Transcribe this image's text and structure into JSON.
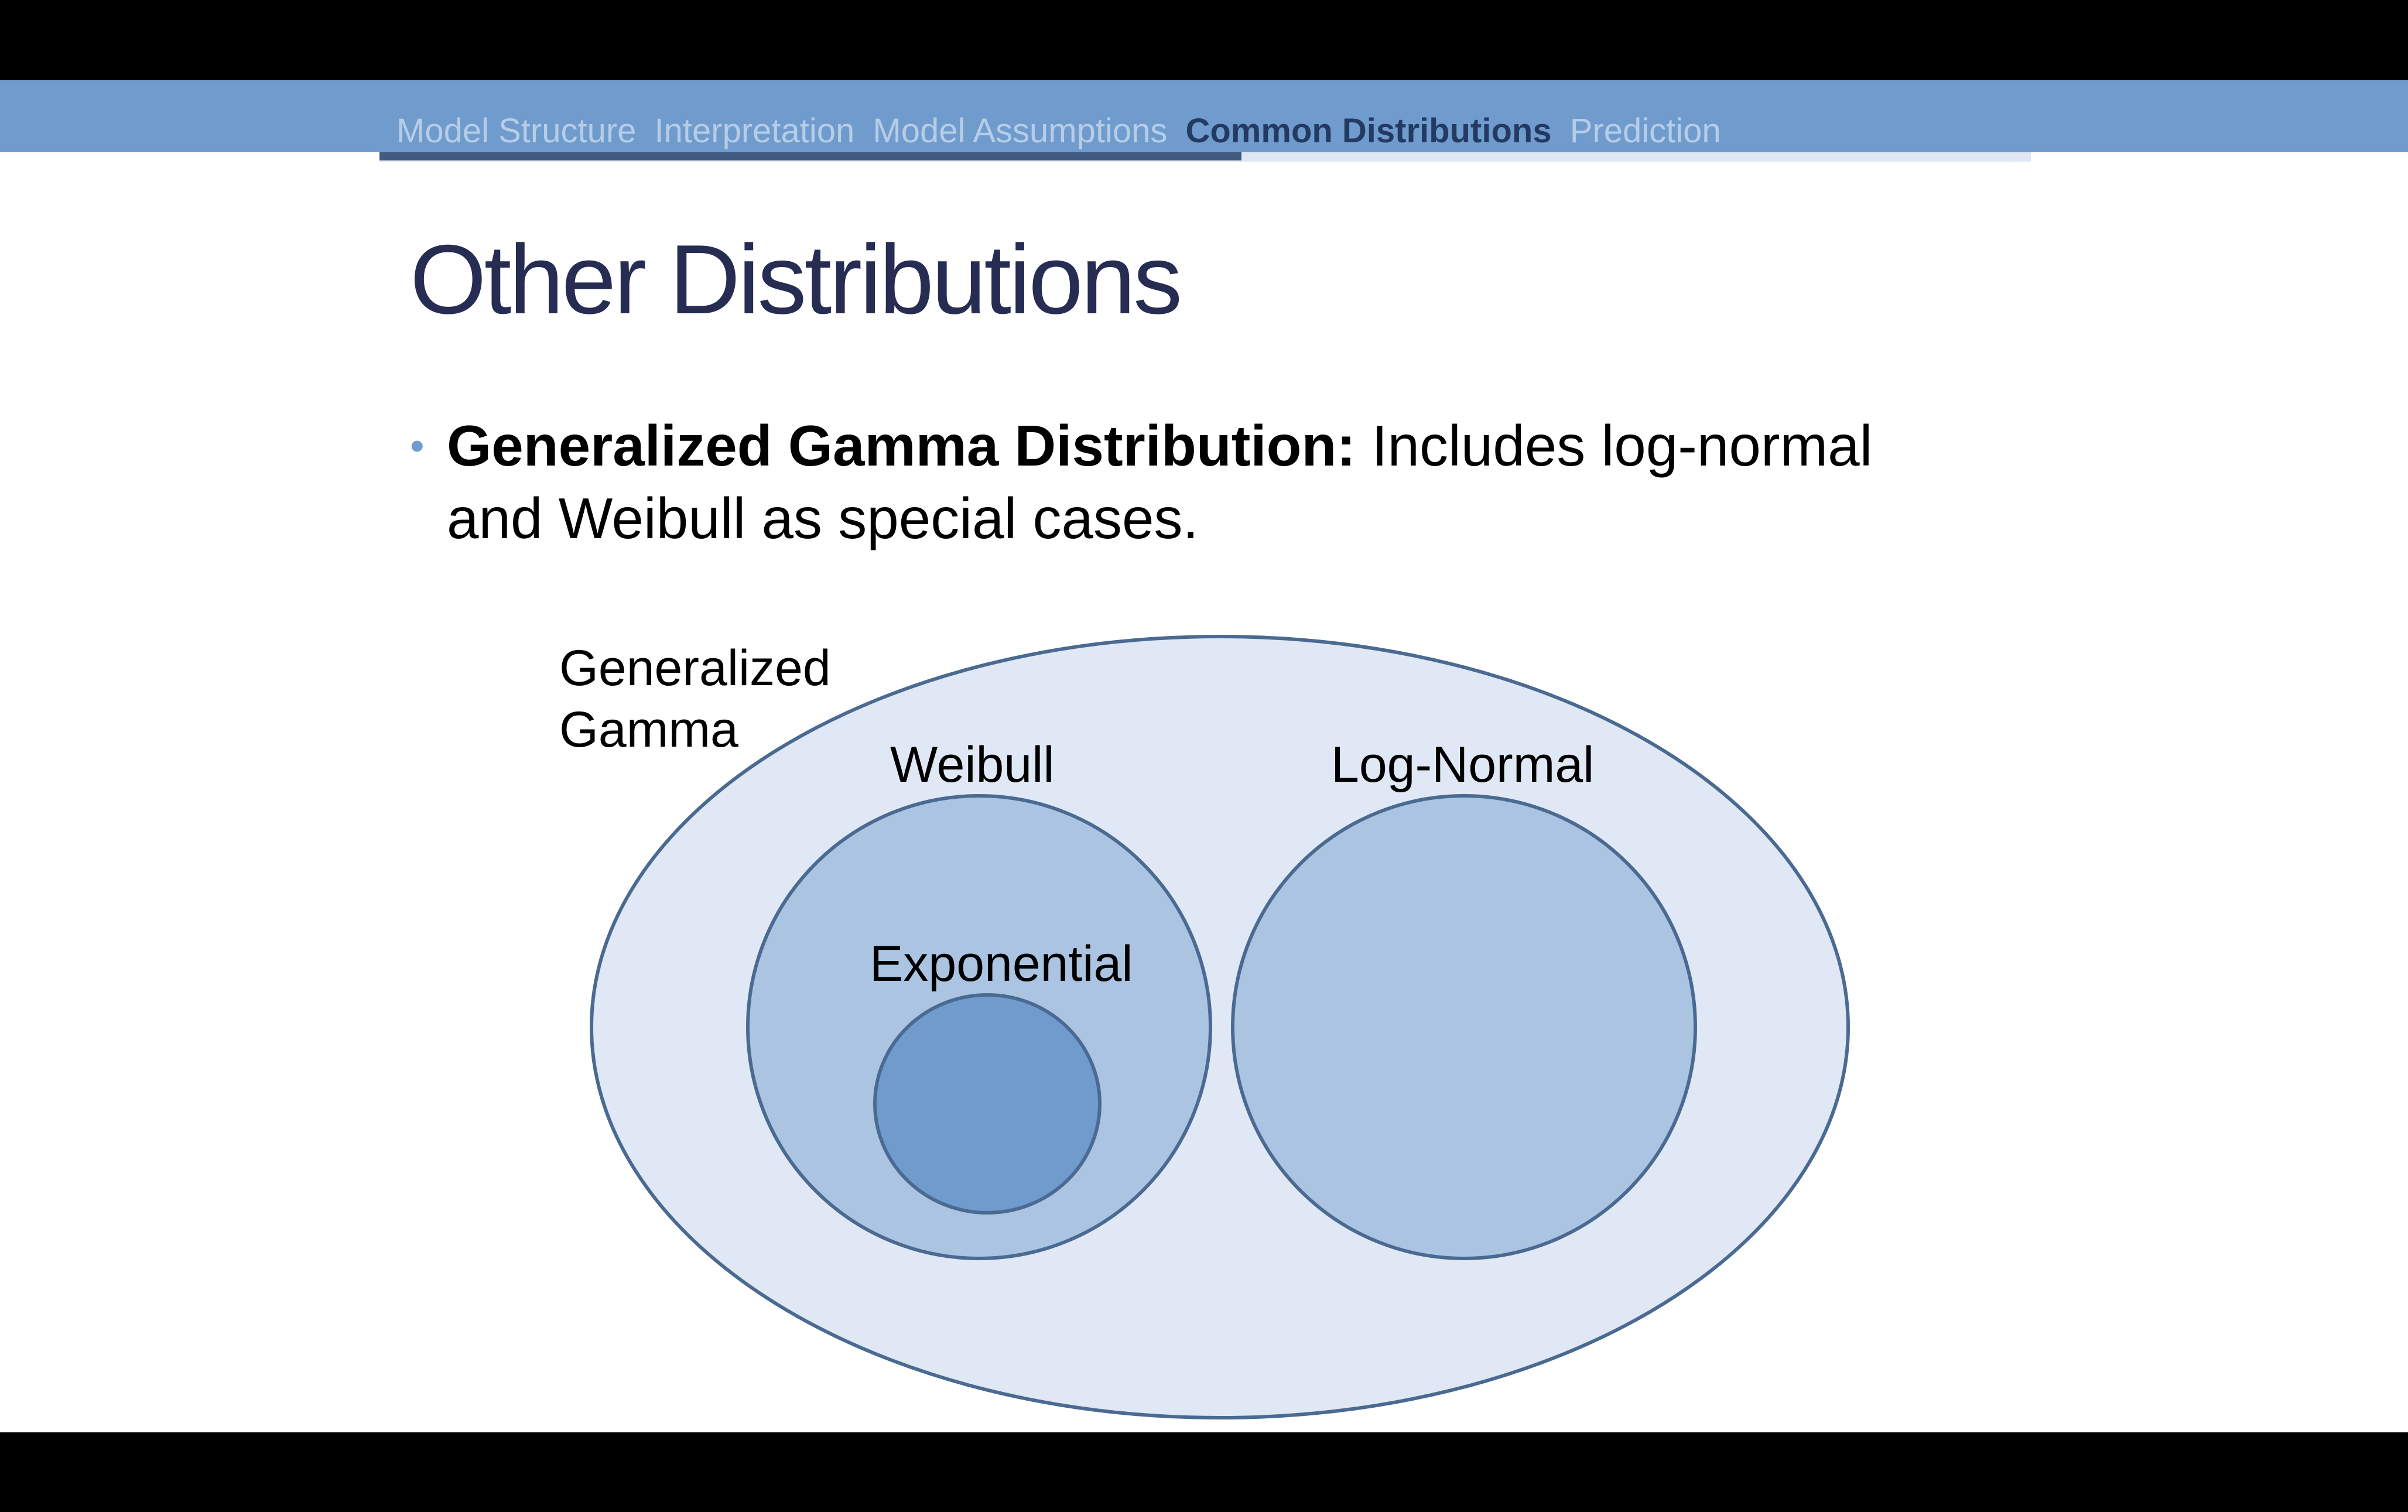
{
  "nav": {
    "items": [
      {
        "label": "Model Structure",
        "active": false
      },
      {
        "label": "Interpretation",
        "active": false
      },
      {
        "label": "Model Assumptions",
        "active": false
      },
      {
        "label": "Common Distributions",
        "active": true
      },
      {
        "label": "Prediction",
        "active": false
      }
    ]
  },
  "slide": {
    "title": "Other Distributions",
    "bullet": {
      "bold": "Generalized Gamma Distribution:",
      "text": " Includes log-normal and Weibull as special cases."
    }
  },
  "diagram": {
    "labels": {
      "outer_line1": "Generalized",
      "outer_line2": "Gamma",
      "weibull": "Weibull",
      "lognormal": "Log-Normal",
      "exponential": "Exponential"
    },
    "colors": {
      "outer_fill": "#dfe8f4",
      "middle_fill": "#aac4e2",
      "inner_fill": "#6f9ccd",
      "stroke": "#4b6a92"
    }
  },
  "colors": {
    "accent": "#6f9ccd",
    "title": "#262c52",
    "nav_active": "#243a63",
    "nav_inactive": "#b7cde7",
    "progress": "#415a82"
  }
}
